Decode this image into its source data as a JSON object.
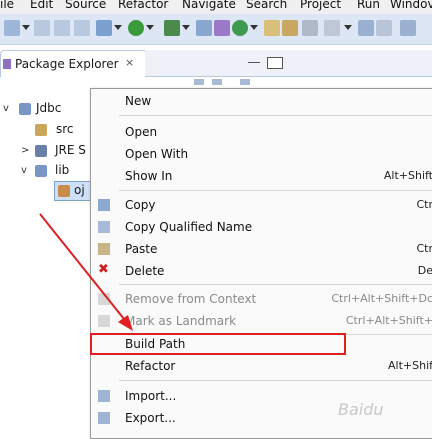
{
  "menubar": [
    "ile",
    "Edit",
    "Source",
    "Refactor",
    "Navigate",
    "Search",
    "Project",
    "Run",
    "Windov"
  ],
  "explorer": {
    "title": "Package Explorer",
    "close_glyph": "×",
    "tree": [
      {
        "label": "Jdbc",
        "icon": "project-folder-icon"
      },
      {
        "label": "src",
        "icon": "package-folder-icon"
      },
      {
        "label": "JRE S",
        "icon": "library-icon"
      },
      {
        "label": "lib",
        "icon": "folder-icon"
      },
      {
        "label": "oj",
        "icon": "jar-file-icon"
      }
    ]
  },
  "menu": {
    "items": [
      {
        "label": "New",
        "shortcut": "",
        "icon": "",
        "enabled": true
      },
      {
        "label": "Open",
        "shortcut": "",
        "icon": "",
        "enabled": true
      },
      {
        "label": "Open With",
        "shortcut": "",
        "icon": "",
        "enabled": true
      },
      {
        "label": "Show In",
        "shortcut": "Alt+Shift",
        "icon": "",
        "enabled": true
      },
      {
        "label": "Copy",
        "shortcut": "Ctr",
        "icon": "copy-icon",
        "enabled": true
      },
      {
        "label": "Copy Qualified Name",
        "shortcut": "",
        "icon": "copy-qualified-icon",
        "enabled": true
      },
      {
        "label": "Paste",
        "shortcut": "Ctr",
        "icon": "paste-icon",
        "enabled": true
      },
      {
        "label": "Delete",
        "shortcut": "De",
        "icon": "delete-icon",
        "enabled": true
      },
      {
        "label": "Remove from Context",
        "shortcut": "Ctrl+Alt+Shift+Dc",
        "icon": "remove-context-icon",
        "enabled": false
      },
      {
        "label": "Mark as Landmark",
        "shortcut": "Ctrl+Alt+Shift+",
        "icon": "landmark-icon",
        "enabled": false
      },
      {
        "label": "Build Path",
        "shortcut": "",
        "icon": "",
        "enabled": true
      },
      {
        "label": "Refactor",
        "shortcut": "Alt+Shif",
        "icon": "",
        "enabled": true
      },
      {
        "label": "Import...",
        "shortcut": "",
        "icon": "import-icon",
        "enabled": true
      },
      {
        "label": "Export...",
        "shortcut": "",
        "icon": "export-icon",
        "enabled": true
      }
    ]
  },
  "annotation": {
    "color": "#e02020"
  },
  "watermark": "Baidu"
}
